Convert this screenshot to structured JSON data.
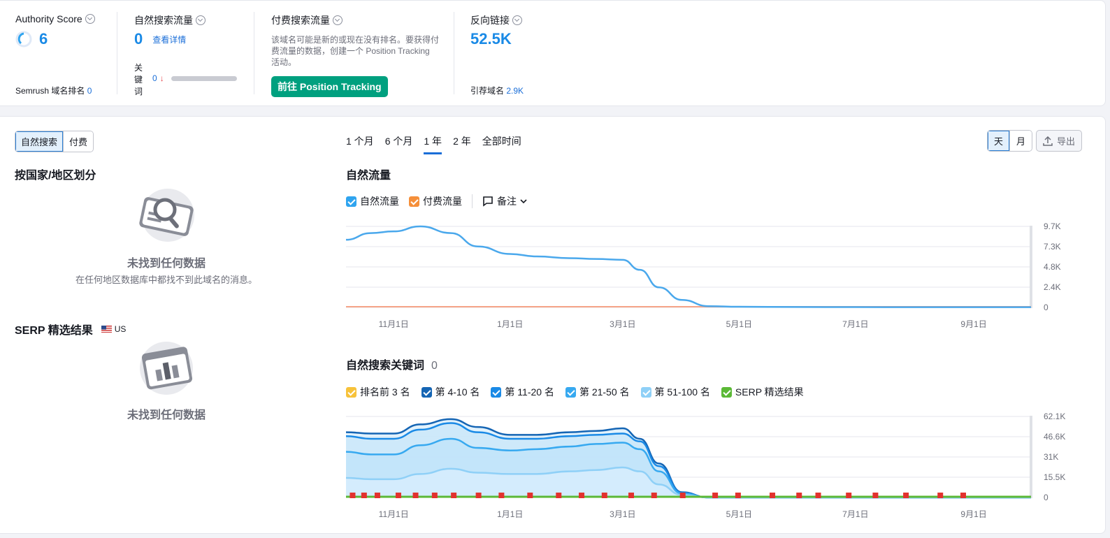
{
  "top": {
    "authority": {
      "title": "Authority Score",
      "value": "6",
      "rank_label": "Semrush 域名排名",
      "rank_value": "0"
    },
    "organic": {
      "title": "自然搜索流量",
      "value": "0",
      "details_link": "查看详情",
      "kw_label": "关键词",
      "kw_value": "0",
      "kw_arrow": "↓"
    },
    "paid": {
      "title": "付费搜索流量",
      "desc": "该域名可能是新的或现在没有排名。要获得付费流量的数据，创建一个 Position Tracking 活动。",
      "button": "前往 Position Tracking"
    },
    "backlinks": {
      "title": "反向链接",
      "value": "52.5K",
      "ref_label": "引荐域名",
      "ref_value": "2.9K"
    }
  },
  "left": {
    "tabs": [
      "自然搜索",
      "付费"
    ],
    "country_title": "按国家/地区划分",
    "empty_title": "未找到任何数据",
    "empty_sub": "在任何地区数据库中都找不到此域名的消息。",
    "serp_title": "SERP 精选结果",
    "serp_country": "US",
    "serp_empty_title": "未找到任何数据"
  },
  "periods": [
    "1 个月",
    "6 个月",
    "1 年",
    "2 年",
    "全部时间"
  ],
  "active_period": "1 年",
  "granularity": [
    "天",
    "月"
  ],
  "export_label": "导出",
  "traffic": {
    "title": "自然流量",
    "legend": [
      {
        "label": "自然流量",
        "color": "#2fa4ef"
      },
      {
        "label": "付费流量",
        "color": "#f58f3a"
      }
    ],
    "notes_label": "备注"
  },
  "keywords": {
    "title": "自然搜索关键词",
    "count": "0",
    "legend": [
      {
        "label": "排名前 3 名",
        "color": "#f7c23a"
      },
      {
        "label": "第 4-10 名",
        "color": "#1565b4"
      },
      {
        "label": "第 11-20 名",
        "color": "#1a8ae6"
      },
      {
        "label": "第 21-50 名",
        "color": "#37a9f0"
      },
      {
        "label": "第 51-100 名",
        "color": "#8fd0f7"
      },
      {
        "label": "SERP 精选结果",
        "color": "#5bb936"
      }
    ]
  },
  "chart_data": [
    {
      "type": "line",
      "title": "自然流量",
      "x_ticks": [
        "11月1日",
        "1月1日",
        "3月1日",
        "5月1日",
        "7月1日",
        "9月1日"
      ],
      "y_ticks": [
        "9.7K",
        "7.3K",
        "4.8K",
        "2.4K",
        "0"
      ],
      "ylim": [
        0,
        9700
      ],
      "series": [
        {
          "name": "自然流量",
          "color": "#4aa8ec",
          "x": [
            "10月7日",
            "10月20日",
            "11月1日",
            "11月15日",
            "12月1日",
            "12月15日",
            "1月1日",
            "1月15日",
            "2月1日",
            "2月15日",
            "3月1日",
            "3月10日",
            "3月20日",
            "4月1日",
            "4月15日",
            "5月1日",
            "6月1日",
            "7月1日",
            "8月1日",
            "9月1日",
            "10月1日"
          ],
          "values": [
            8100,
            8900,
            9100,
            9700,
            8900,
            7300,
            6400,
            6100,
            5900,
            5800,
            5700,
            4500,
            2400,
            900,
            150,
            80,
            50,
            40,
            30,
            30,
            30
          ]
        },
        {
          "name": "付费流量",
          "color": "#f5a488",
          "x": [
            "10月7日",
            "10月1日"
          ],
          "values": [
            0,
            0
          ]
        }
      ]
    },
    {
      "type": "area",
      "title": "自然搜索关键词",
      "x_ticks": [
        "11月1日",
        "1月1日",
        "3月1日",
        "5月1日",
        "7月1日",
        "9月1日"
      ],
      "y_ticks": [
        "62.1K",
        "46.6K",
        "31K",
        "15.5K",
        "0"
      ],
      "ylim": [
        0,
        62100
      ],
      "x": [
        "10月7日",
        "10月20日",
        "11月1日",
        "11月15日",
        "12月1日",
        "12月15日",
        "1月1日",
        "1月15日",
        "2月1日",
        "2月15日",
        "3月1日",
        "3月10日",
        "3月20日",
        "4月1日",
        "4月15日",
        "5月1日",
        "10月1日"
      ],
      "series": [
        {
          "name": "第 4-10 名",
          "color": "#1565b4",
          "values": [
            50000,
            49000,
            49000,
            56000,
            60000,
            54000,
            48000,
            48000,
            50000,
            51000,
            53000,
            45000,
            26000,
            4000,
            0,
            0,
            0
          ]
        },
        {
          "name": "第 11-20 名",
          "color": "#1a8ae6",
          "values": [
            47000,
            45000,
            45000,
            52000,
            57000,
            50000,
            45000,
            45000,
            47000,
            48000,
            49000,
            43000,
            24000,
            3500,
            0,
            0,
            0
          ]
        },
        {
          "name": "第 21-50 名",
          "color": "#37a9f0",
          "values": [
            35000,
            33000,
            33000,
            40000,
            45000,
            38000,
            36000,
            37000,
            39000,
            41000,
            42000,
            37000,
            20000,
            3000,
            0,
            0,
            0
          ]
        },
        {
          "name": "第 51-100 名",
          "color": "#8fd0f7",
          "values": [
            15000,
            14000,
            14000,
            18000,
            22000,
            19000,
            18000,
            18000,
            20000,
            21000,
            23000,
            20000,
            10000,
            2000,
            0,
            0,
            0
          ]
        },
        {
          "name": "SERP 精选结果",
          "color": "#5bb936",
          "values": [
            0,
            0,
            0,
            0,
            0,
            0,
            0,
            0,
            0,
            0,
            0,
            0,
            0,
            0,
            0,
            0,
            0
          ]
        }
      ]
    }
  ]
}
